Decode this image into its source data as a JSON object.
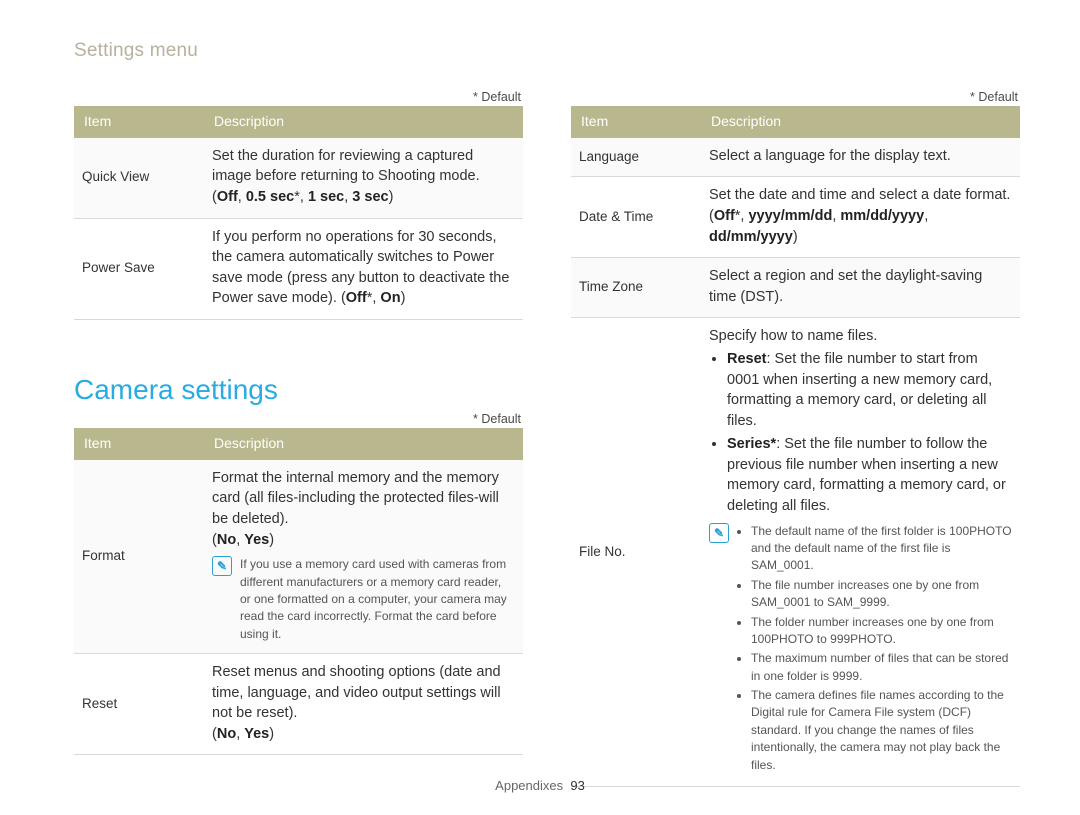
{
  "crumb": "Settings menu",
  "default_label": "* Default",
  "headers": {
    "item": "Item",
    "desc": "Description"
  },
  "section_title_camera": "Camera settings",
  "footer": {
    "section": "Appendixes",
    "page": "93"
  },
  "left1": [
    {
      "item": "Quick View",
      "desc": "Set the duration for reviewing a captured image before returning to Shooting mode.",
      "opts": "(Off, 0.5 sec*, 1 sec, 3 sec)"
    },
    {
      "item": "Power Save",
      "desc": "If you perform no operations for 30 seconds, the camera automatically switches to Power save mode (press any button to deactivate the Power save mode). (",
      "opts_inline": "Off*, On",
      "desc_tail": ")"
    }
  ],
  "left2": [
    {
      "item": "Format",
      "desc": "Format the internal memory and the memory card (all files-including the protected files-will be deleted).",
      "opts": "(No, Yes)",
      "note": "If you use a memory card used with cameras from different manufacturers or a memory card reader, or one formatted on a computer, your camera may read the card incorrectly. Format the card before using it."
    },
    {
      "item": "Reset",
      "desc": "Reset menus and shooting options (date and time, language, and video output settings will not be reset).",
      "opts": "(No, Yes)"
    }
  ],
  "right": [
    {
      "item": "Language",
      "desc": "Select a language for the display text."
    },
    {
      "item": "Date & Time",
      "desc": "Set the date and time and select a date format.",
      "opts": "(Off*, yyyy/mm/dd, mm/dd/yyyy, dd/mm/yyyy)"
    },
    {
      "item": "Time Zone",
      "desc": "Select a region and set the daylight-saving time (DST)."
    },
    {
      "item": "File No.",
      "intro": "Specify how to name files.",
      "bullets": [
        {
          "lead": "Reset",
          "text": ": Set the file number to start from 0001 when inserting a new memory card, formatting a memory card, or deleting all files."
        },
        {
          "lead": "Series*",
          "text": ": Set the file number to follow the previous file number when inserting a new memory card, formatting a memory card, or deleting all files."
        }
      ],
      "note_list": [
        "The default name of the first folder is 100PHOTO and the default name of the first file is SAM_0001.",
        "The file number increases one by one from SAM_0001 to SAM_9999.",
        "The folder number increases one by one from 100PHOTO to 999PHOTO.",
        "The maximum number of files that can be stored in one folder is 9999.",
        "The camera defines file names according to the Digital rule for Camera File system (DCF) standard. If you change the names of files intentionally, the camera may not play back the files."
      ]
    }
  ]
}
